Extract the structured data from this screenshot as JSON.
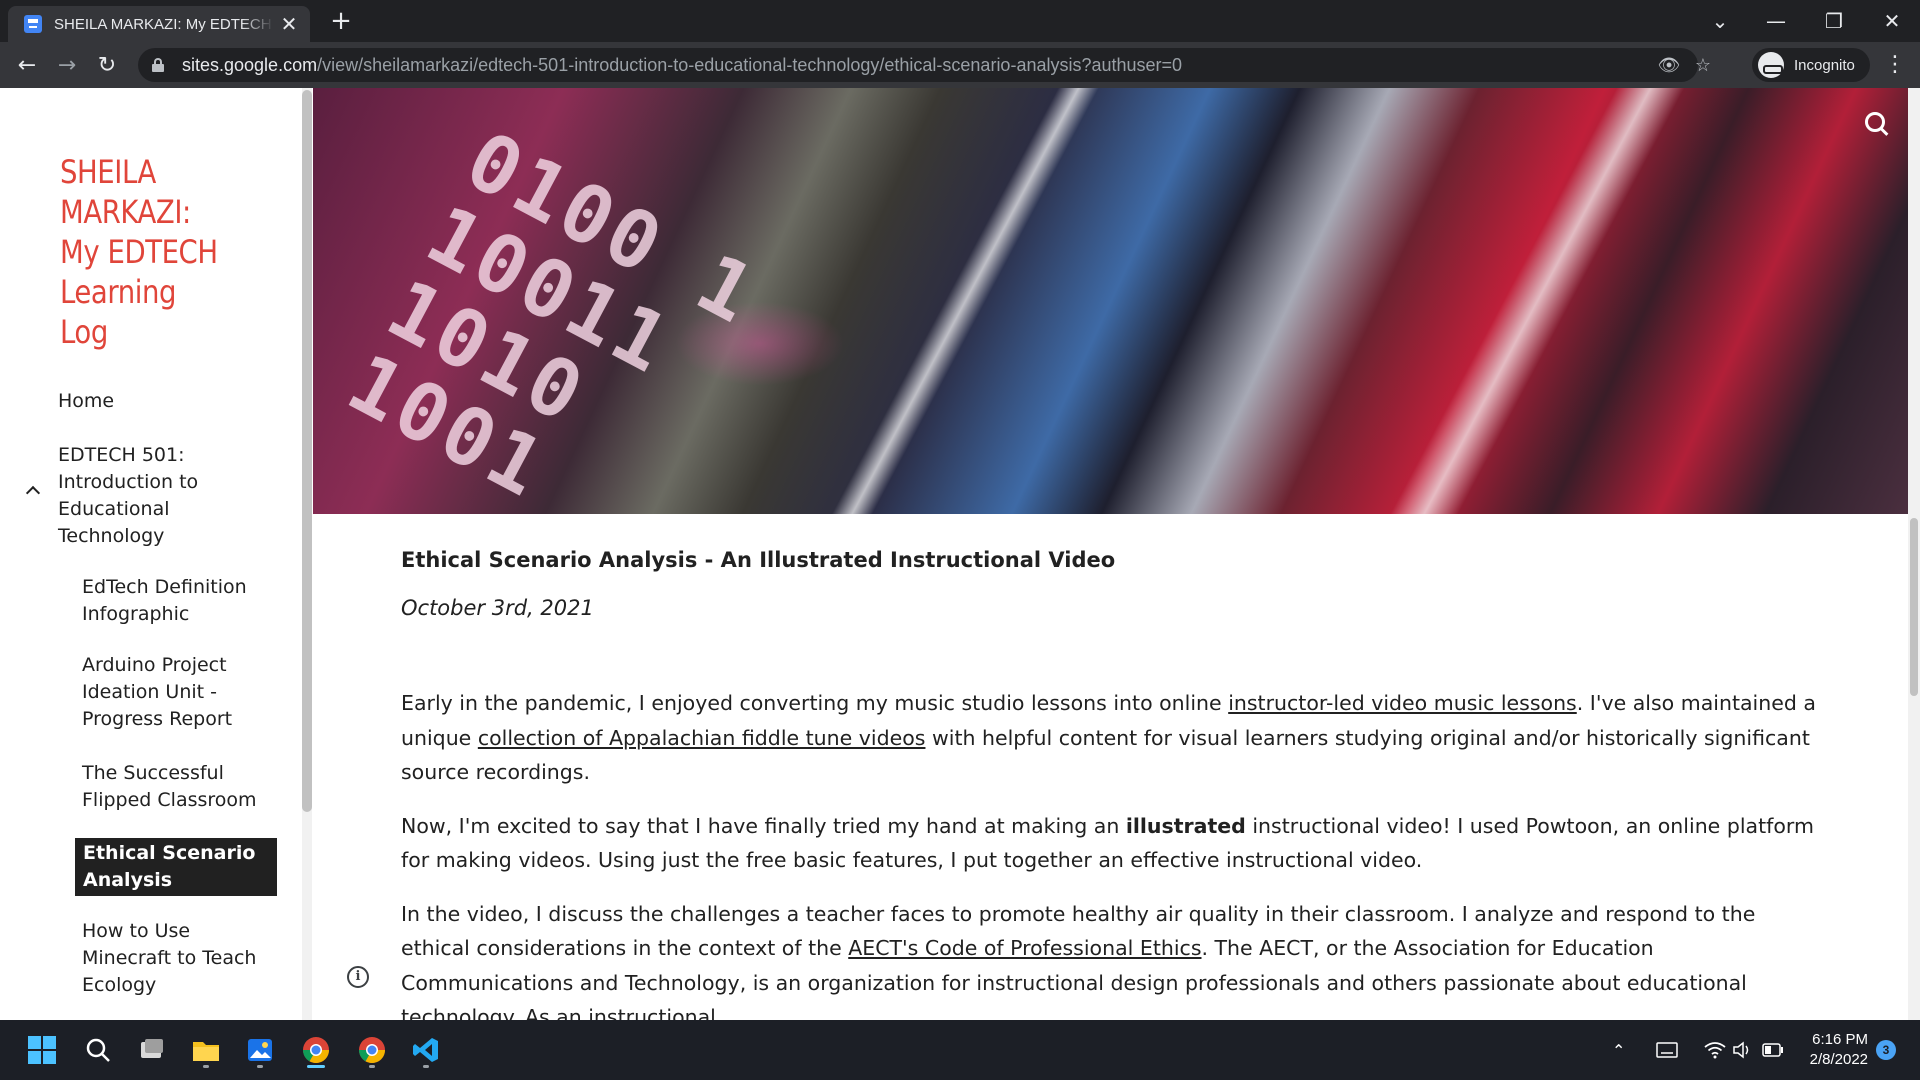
{
  "browser": {
    "tab_title": "SHEILA MARKAZI: My EDTECH Learning Log",
    "new_tab": "+",
    "close_tab": "✕",
    "url_host": "sites.google.com",
    "url_path": "/view/sheilamarkazi/edtech-501-introduction-to-educational-technology/ethical-scenario-analysis?authuser=0",
    "profile_label": "Incognito"
  },
  "sidebar": {
    "site_title": "SHEILA MARKAZI: My EDTECH Learning Log",
    "nav": [
      {
        "label": "Home"
      },
      {
        "label": "EDTECH 501: Introduction to Educational Technology"
      },
      {
        "label": "EdTech Definition Infographic"
      },
      {
        "label": "Arduino Project Ideation Unit - Progress Report"
      },
      {
        "label": "The Successful Flipped Classroom"
      },
      {
        "label": "Ethical Scenario Analysis"
      },
      {
        "label": "How to Use Minecraft to Teach Ecology"
      }
    ]
  },
  "hero": {
    "binary_lines": [
      "0100 1",
      "10011",
      "1010",
      "1001"
    ]
  },
  "article": {
    "title": "Ethical Scenario Analysis - An Illustrated Instructional Video",
    "date": "October 3rd, 2021",
    "p1": {
      "t1": "Early in the pandemic, I enjoyed converting my music studio lessons into online ",
      "link1": "instructor-led video music lessons",
      "t2": ". I've also maintained a unique ",
      "link2": "collection of Appalachian fiddle tune videos",
      "t3": " with helpful content for visual learners studying original and/or historically significant source recordings."
    },
    "p2": {
      "t1": "Now, I'm excited to say that I have finally tried my hand at making an ",
      "bold": "illustrated",
      "t2": " instructional video! I used Powtoon, an online platform for making videos. Using just the free basic features, I put together an effective instructional video."
    },
    "p3": {
      "t1": "In the video, I discuss the challenges a teacher faces to promote healthy air quality in their classroom. I analyze and respond to the ethical considerations in the context of the ",
      "link1": "AECT's Code of Professional Ethics",
      "t2": ". The AECT, or the Association for Education Communications and Technology, is an organization for instructional design professionals and others passionate about educational technology. As an instructional"
    }
  },
  "taskbar": {
    "time": "6:16 PM",
    "date": "2/8/2022",
    "notification_count": "3"
  }
}
